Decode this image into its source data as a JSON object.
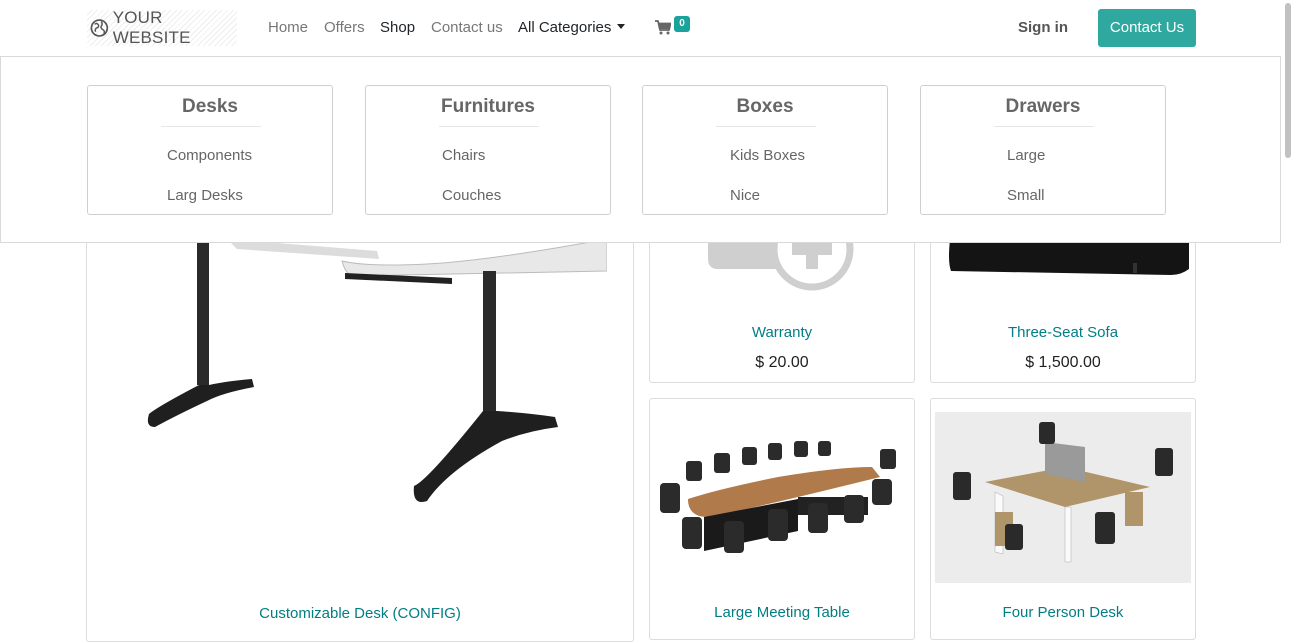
{
  "header": {
    "logo_text": "YOUR WEBSITE",
    "nav": [
      {
        "label": "Home"
      },
      {
        "label": "Offers"
      },
      {
        "label": "Shop"
      },
      {
        "label": "Contact us"
      },
      {
        "label": "All Categories"
      }
    ],
    "cart_count": "0",
    "sign_in": "Sign in",
    "contact_button": "Contact Us"
  },
  "mega_menu": {
    "categories": [
      {
        "title": "Desks",
        "items": [
          "Components",
          "Larg Desks"
        ]
      },
      {
        "title": "Furnitures",
        "items": [
          "Chairs",
          "Couches"
        ]
      },
      {
        "title": "Boxes",
        "items": [
          "Kids Boxes",
          "Nice"
        ]
      },
      {
        "title": "Drawers",
        "items": [
          "Large",
          "Small"
        ]
      }
    ]
  },
  "products": [
    {
      "name": "Customizable Desk (CONFIG)"
    },
    {
      "name": "Warranty",
      "price": "$ 20.00"
    },
    {
      "name": "Three-Seat Sofa",
      "price": "$ 1,500.00"
    },
    {
      "name": "Large Meeting Table"
    },
    {
      "name": "Four Person Desk"
    }
  ],
  "colors": {
    "accent": "#2fa99f",
    "link": "#017e84",
    "badge": "#1aa39a"
  }
}
